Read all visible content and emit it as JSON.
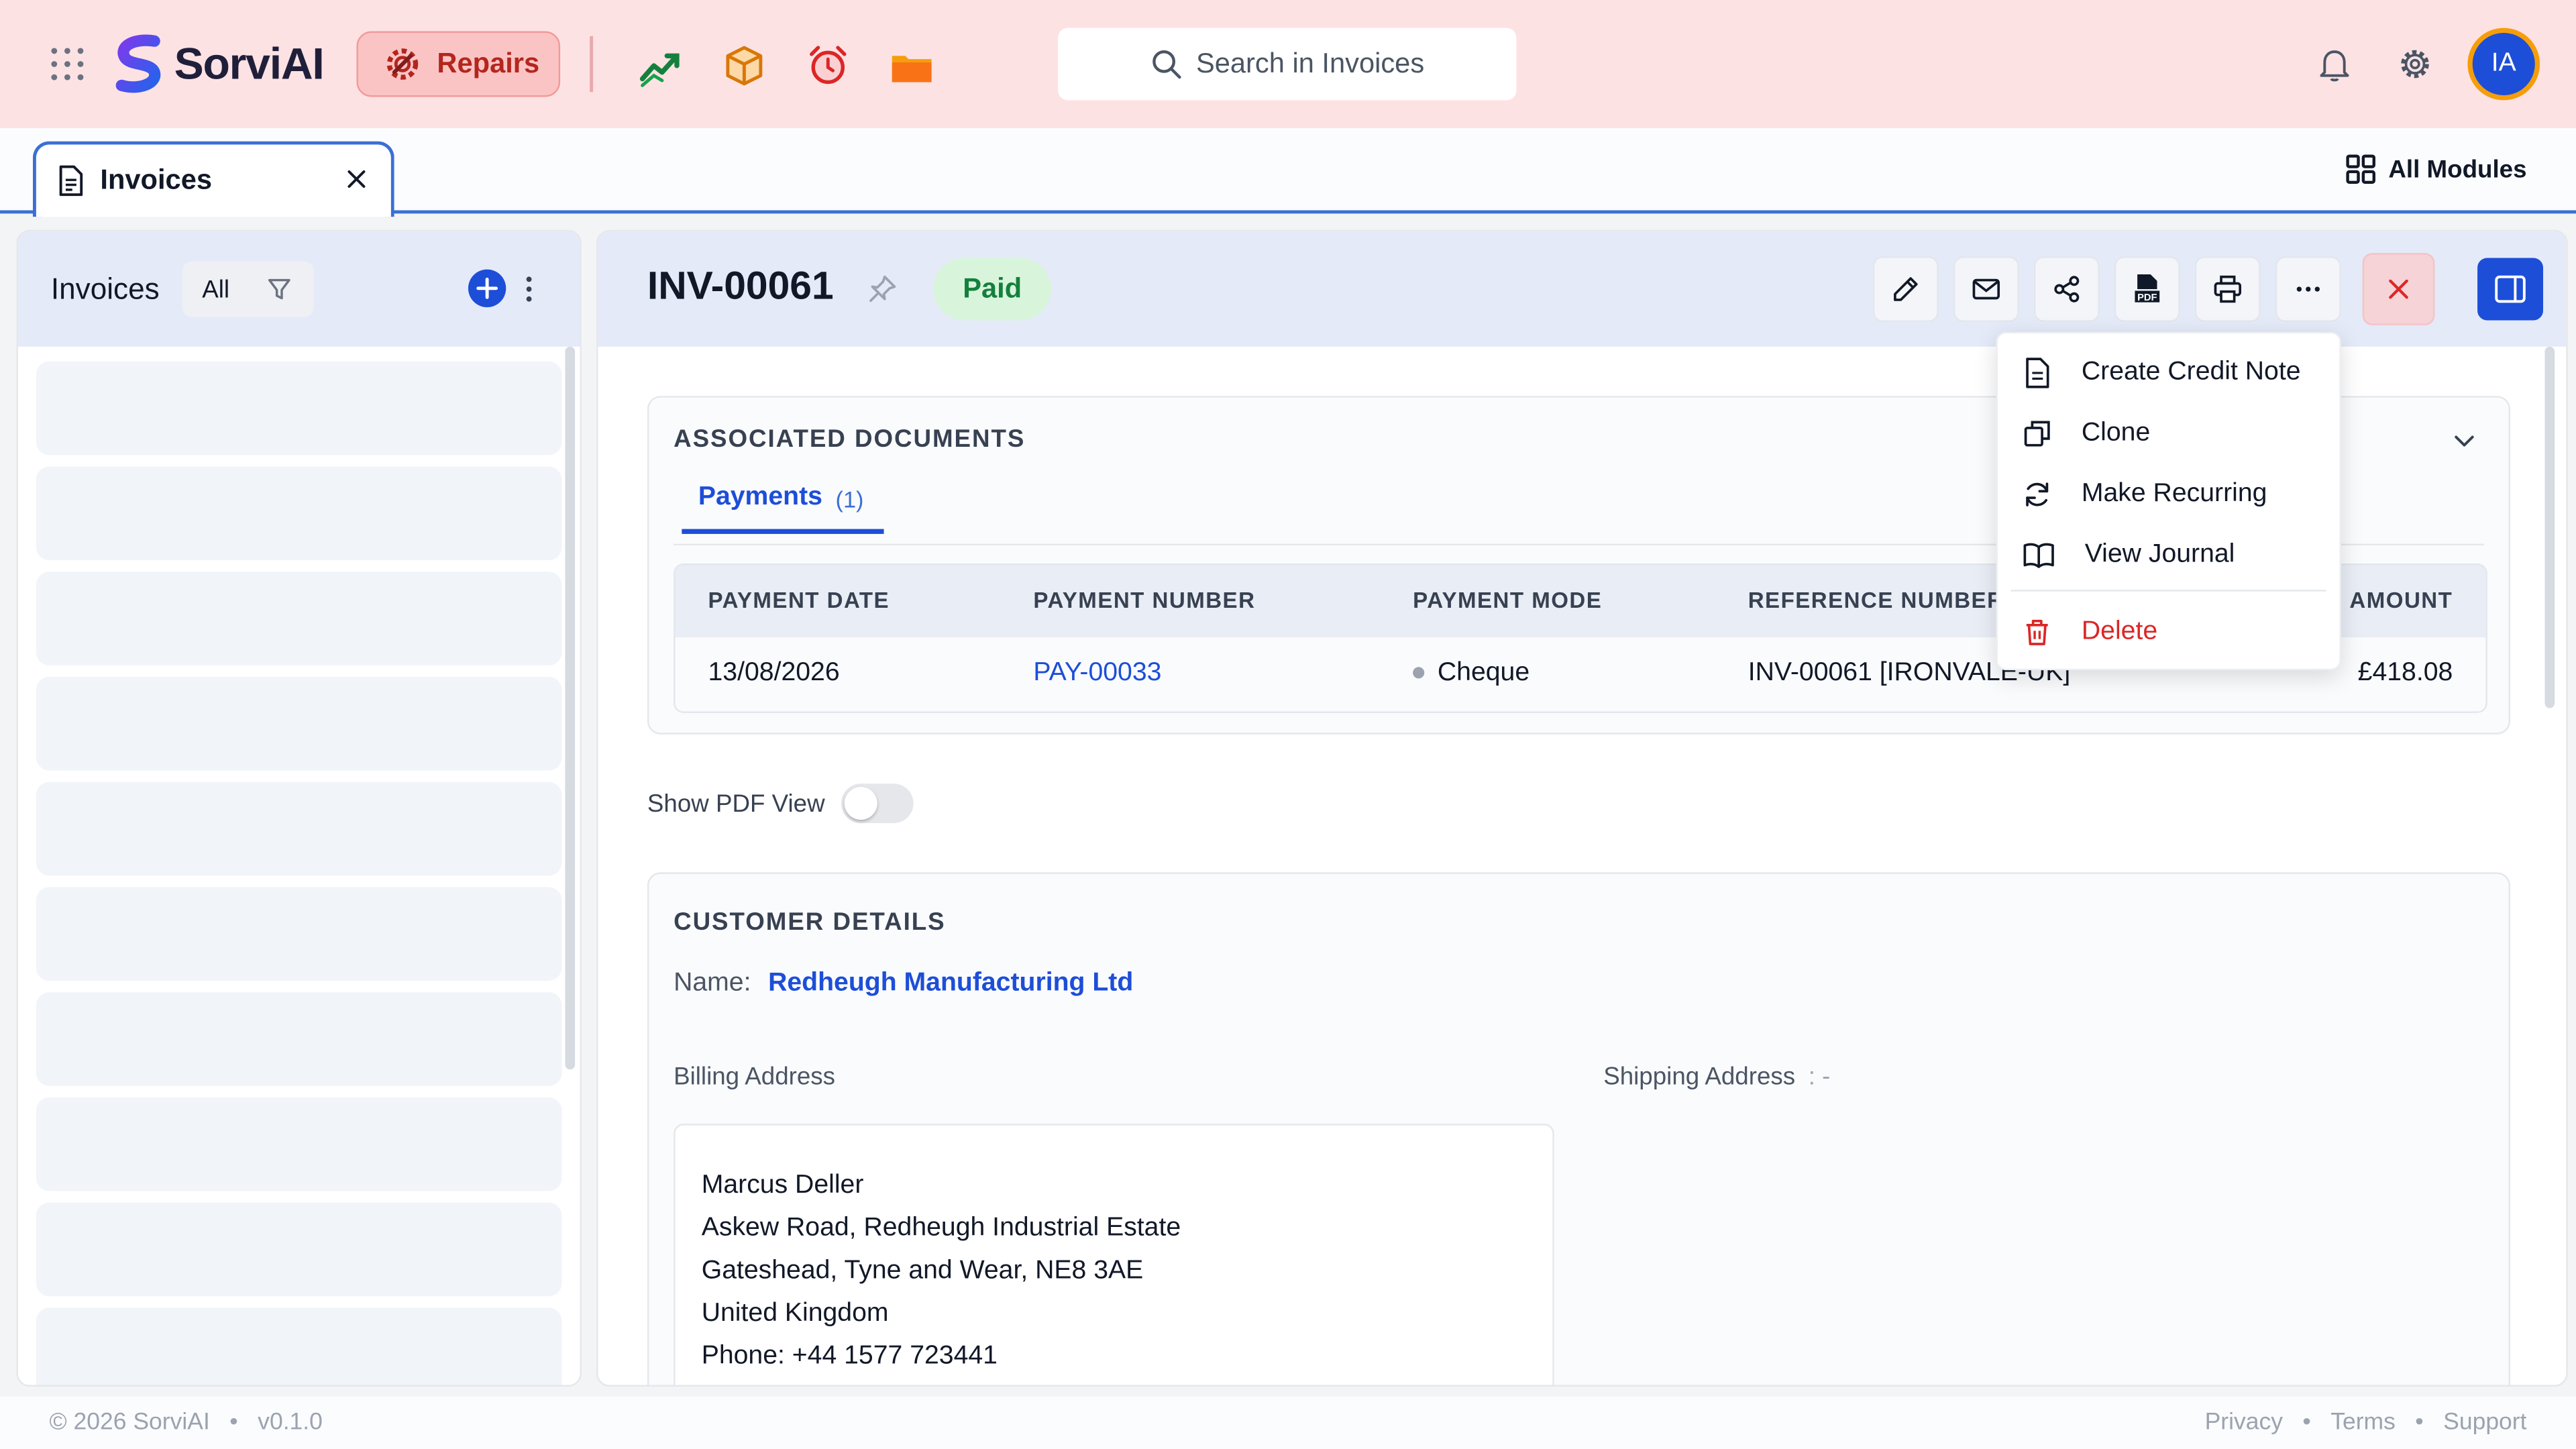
{
  "brand": {
    "name": "SorviAI"
  },
  "topbar": {
    "module": "Repairs",
    "search_placeholder": "Search in Invoices",
    "avatar_initials": "IA",
    "app_icons": [
      "chart-trend-icon",
      "package-icon",
      "alarm-clock-icon",
      "folder-icon"
    ]
  },
  "tabs": [
    {
      "label": "Invoices"
    }
  ],
  "all_modules": "All Modules",
  "list_panel": {
    "title": "Invoices",
    "filter": "All"
  },
  "invoice": {
    "number": "INV-00061",
    "status": "Paid",
    "status_color": "#15803d"
  },
  "associated": {
    "title": "ASSOCIATED DOCUMENTS",
    "tab_label": "Payments",
    "tab_count": "(1)",
    "columns": [
      "PAYMENT DATE",
      "PAYMENT NUMBER",
      "PAYMENT MODE",
      "REFERENCE NUMBER",
      "AMOUNT"
    ],
    "rows": [
      {
        "date": "13/08/2026",
        "number": "PAY-00033",
        "mode": "Cheque",
        "reference": "INV-00061 [IRONVALE-UK]",
        "amount": "£418.08"
      }
    ]
  },
  "pdf_toggle": {
    "label": "Show PDF View",
    "state": "off"
  },
  "customer": {
    "title": "CUSTOMER DETAILS",
    "name_label": "Name:",
    "name": "Redheugh Manufacturing Ltd",
    "billing_label": "Billing Address",
    "shipping_label": "Shipping Address",
    "shipping_value": ": -",
    "billing_lines": [
      "Marcus Deller",
      "Askew Road, Redheugh Industrial Estate",
      "Gateshead, Tyne and Wear, NE8 3AE",
      "United Kingdom",
      "Phone: +44 1577 723441"
    ]
  },
  "menu": {
    "items": [
      "Create Credit Note",
      "Clone",
      "Make Recurring",
      "View Journal"
    ],
    "delete": "Delete"
  },
  "footer": {
    "copyright": "© 2026 SorviAI",
    "version": "v0.1.0",
    "links": [
      "Privacy",
      "Terms",
      "Support"
    ],
    "dot": "•"
  },
  "colors": {
    "accent": "#1d4ed8",
    "topbar_bg": "#fde2e4",
    "danger": "#dc2626",
    "success_bg": "#d8f5dc"
  }
}
